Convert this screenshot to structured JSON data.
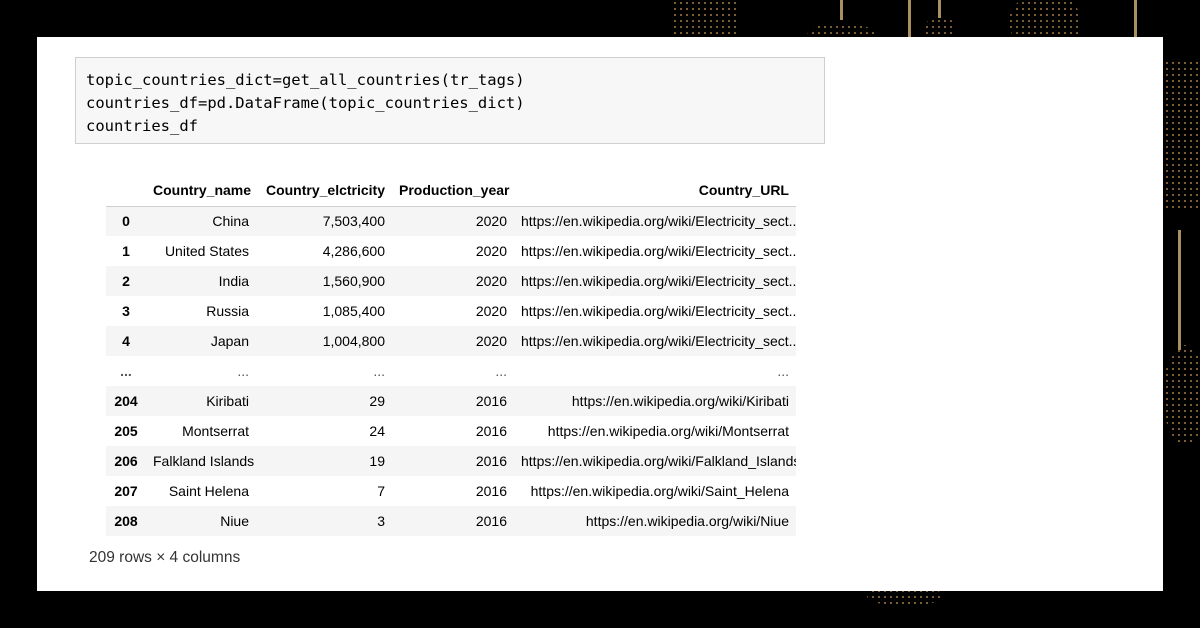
{
  "code": {
    "lines": [
      "topic_countries_dict=get_all_countries(tr_tags)",
      "countries_df=pd.DataFrame(topic_countries_dict)",
      "countries_df"
    ]
  },
  "table": {
    "columns": [
      "",
      "Country_name",
      "Country_elctricity",
      "Production_year",
      "Country_URL"
    ],
    "rows": [
      {
        "idx": "0",
        "name": "China",
        "elec": "7,503,400",
        "year": "2020",
        "url": "https://en.wikipedia.org/wiki/Electricity_sect..."
      },
      {
        "idx": "1",
        "name": "United States",
        "elec": "4,286,600",
        "year": "2020",
        "url": "https://en.wikipedia.org/wiki/Electricity_sect..."
      },
      {
        "idx": "2",
        "name": "India",
        "elec": "1,560,900",
        "year": "2020",
        "url": "https://en.wikipedia.org/wiki/Electricity_sect..."
      },
      {
        "idx": "3",
        "name": "Russia",
        "elec": "1,085,400",
        "year": "2020",
        "url": "https://en.wikipedia.org/wiki/Electricity_sect..."
      },
      {
        "idx": "4",
        "name": "Japan",
        "elec": "1,004,800",
        "year": "2020",
        "url": "https://en.wikipedia.org/wiki/Electricity_sect..."
      },
      {
        "idx": "...",
        "name": "...",
        "elec": "...",
        "year": "...",
        "url": "..."
      },
      {
        "idx": "204",
        "name": "Kiribati",
        "elec": "29",
        "year": "2016",
        "url": "https://en.wikipedia.org/wiki/Kiribati"
      },
      {
        "idx": "205",
        "name": "Montserrat",
        "elec": "24",
        "year": "2016",
        "url": "https://en.wikipedia.org/wiki/Montserrat"
      },
      {
        "idx": "206",
        "name": "Falkland Islands",
        "elec": "19",
        "year": "2016",
        "url": "https://en.wikipedia.org/wiki/Falkland_Islands"
      },
      {
        "idx": "207",
        "name": "Saint Helena",
        "elec": "7",
        "year": "2016",
        "url": "https://en.wikipedia.org/wiki/Saint_Helena"
      },
      {
        "idx": "208",
        "name": "Niue",
        "elec": "3",
        "year": "2016",
        "url": "https://en.wikipedia.org/wiki/Niue"
      }
    ]
  },
  "summary": "209 rows × 4 columns",
  "colors": {
    "background": "#000000",
    "panel": "#ffffff",
    "decor": "#8a6a3a"
  }
}
